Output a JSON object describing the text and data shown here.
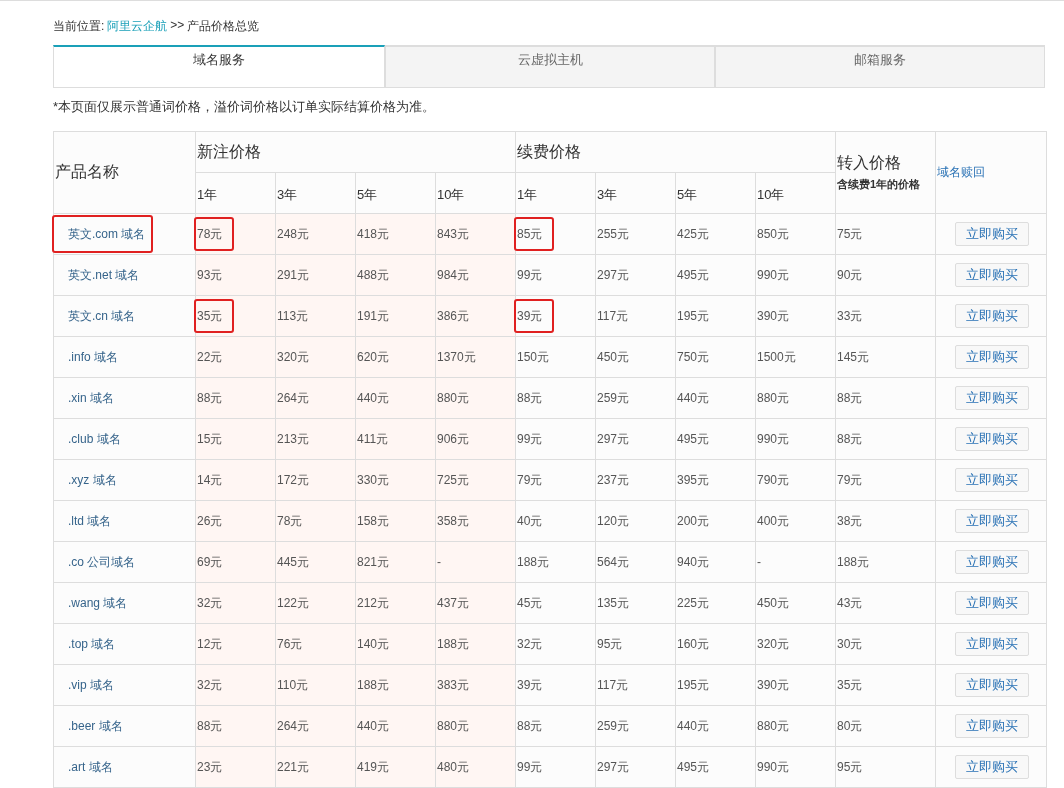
{
  "breadcrumb": {
    "label": "当前位置:",
    "link": "阿里云企航",
    "separator": ">>",
    "current": "产品价格总览"
  },
  "tabs": [
    {
      "label": "域名服务",
      "selected": true
    },
    {
      "label": "云虚拟主机",
      "selected": false
    },
    {
      "label": "邮箱服务",
      "selected": false
    }
  ],
  "note": "*本页面仅展示普通词价格，溢价词价格以订单实际结算价格为准。",
  "table": {
    "name_header": "产品名称",
    "new_header": "新注价格",
    "renew_header": "续费价格",
    "transfer_header": "转入价格",
    "transfer_sub": "含续费1年的价格",
    "redeem_link": "域名赎回",
    "new_years": [
      "1年",
      "3年",
      "5年",
      "10年"
    ],
    "renew_years": [
      "1年",
      "3年",
      "5年",
      "10年"
    ],
    "rows": [
      {
        "name": "英文.com 域名",
        "boxed": true,
        "new": [
          {
            "text": "78元",
            "boxed": true
          },
          {
            "text": "248元",
            "boxed": false
          },
          {
            "text": "418元",
            "boxed": false
          },
          {
            "text": "843元",
            "boxed": false
          }
        ],
        "renew": [
          {
            "text": "85元",
            "boxed": true
          },
          {
            "text": "255元",
            "boxed": false
          },
          {
            "text": "425元",
            "boxed": false
          },
          {
            "text": "850元",
            "boxed": false
          }
        ],
        "transfer": "75元",
        "button": "立即购买"
      },
      {
        "name": "英文.net 域名",
        "boxed": false,
        "new": [
          {
            "text": "93元",
            "boxed": false
          },
          {
            "text": "291元",
            "boxed": false
          },
          {
            "text": "488元",
            "boxed": false
          },
          {
            "text": "984元",
            "boxed": false
          }
        ],
        "renew": [
          {
            "text": "99元",
            "boxed": false
          },
          {
            "text": "297元",
            "boxed": false
          },
          {
            "text": "495元",
            "boxed": false
          },
          {
            "text": "990元",
            "boxed": false
          }
        ],
        "transfer": "90元",
        "button": "立即购买"
      },
      {
        "name": "英文.cn 域名",
        "boxed": false,
        "new": [
          {
            "text": "35元",
            "boxed": true
          },
          {
            "text": "113元",
            "boxed": false
          },
          {
            "text": "191元",
            "boxed": false
          },
          {
            "text": "386元",
            "boxed": false
          }
        ],
        "renew": [
          {
            "text": "39元",
            "boxed": true
          },
          {
            "text": "117元",
            "boxed": false
          },
          {
            "text": "195元",
            "boxed": false
          },
          {
            "text": "390元",
            "boxed": false
          }
        ],
        "transfer": "33元",
        "button": "立即购买"
      },
      {
        "name": ".info 域名",
        "boxed": false,
        "new": [
          {
            "text": "22元",
            "boxed": false
          },
          {
            "text": "320元",
            "boxed": false
          },
          {
            "text": "620元",
            "boxed": false
          },
          {
            "text": "1370元",
            "boxed": false
          }
        ],
        "renew": [
          {
            "text": "150元",
            "boxed": false
          },
          {
            "text": "450元",
            "boxed": false
          },
          {
            "text": "750元",
            "boxed": false
          },
          {
            "text": "1500元",
            "boxed": false
          }
        ],
        "transfer": "145元",
        "button": "立即购买"
      },
      {
        "name": ".xin 域名",
        "boxed": false,
        "new": [
          {
            "text": "88元",
            "boxed": false
          },
          {
            "text": "264元",
            "boxed": false
          },
          {
            "text": "440元",
            "boxed": false
          },
          {
            "text": "880元",
            "boxed": false
          }
        ],
        "renew": [
          {
            "text": "88元",
            "boxed": false
          },
          {
            "text": "259元",
            "boxed": false
          },
          {
            "text": "440元",
            "boxed": false
          },
          {
            "text": "880元",
            "boxed": false
          }
        ],
        "transfer": "88元",
        "button": "立即购买"
      },
      {
        "name": ".club 域名",
        "boxed": false,
        "new": [
          {
            "text": "15元",
            "boxed": false
          },
          {
            "text": "213元",
            "boxed": false
          },
          {
            "text": "411元",
            "boxed": false
          },
          {
            "text": "906元",
            "boxed": false
          }
        ],
        "renew": [
          {
            "text": "99元",
            "boxed": false
          },
          {
            "text": "297元",
            "boxed": false
          },
          {
            "text": "495元",
            "boxed": false
          },
          {
            "text": "990元",
            "boxed": false
          }
        ],
        "transfer": "88元",
        "button": "立即购买"
      },
      {
        "name": ".xyz 域名",
        "boxed": false,
        "new": [
          {
            "text": "14元",
            "boxed": false
          },
          {
            "text": "172元",
            "boxed": false
          },
          {
            "text": "330元",
            "boxed": false
          },
          {
            "text": "725元",
            "boxed": false
          }
        ],
        "renew": [
          {
            "text": "79元",
            "boxed": false
          },
          {
            "text": "237元",
            "boxed": false
          },
          {
            "text": "395元",
            "boxed": false
          },
          {
            "text": "790元",
            "boxed": false
          }
        ],
        "transfer": "79元",
        "button": "立即购买"
      },
      {
        "name": ".ltd 域名",
        "boxed": false,
        "new": [
          {
            "text": "26元",
            "boxed": false
          },
          {
            "text": "78元",
            "boxed": false
          },
          {
            "text": "158元",
            "boxed": false
          },
          {
            "text": "358元",
            "boxed": false
          }
        ],
        "renew": [
          {
            "text": "40元",
            "boxed": false
          },
          {
            "text": "120元",
            "boxed": false
          },
          {
            "text": "200元",
            "boxed": false
          },
          {
            "text": "400元",
            "boxed": false
          }
        ],
        "transfer": "38元",
        "button": "立即购买"
      },
      {
        "name": ".co 公司域名",
        "boxed": false,
        "new": [
          {
            "text": "69元",
            "boxed": false
          },
          {
            "text": "445元",
            "boxed": false
          },
          {
            "text": "821元",
            "boxed": false
          },
          {
            "text": "-",
            "boxed": false
          }
        ],
        "renew": [
          {
            "text": "188元",
            "boxed": false
          },
          {
            "text": "564元",
            "boxed": false
          },
          {
            "text": "940元",
            "boxed": false
          },
          {
            "text": "-",
            "boxed": false
          }
        ],
        "transfer": "188元",
        "button": "立即购买"
      },
      {
        "name": ".wang 域名",
        "boxed": false,
        "new": [
          {
            "text": "32元",
            "boxed": false
          },
          {
            "text": "122元",
            "boxed": false
          },
          {
            "text": "212元",
            "boxed": false
          },
          {
            "text": "437元",
            "boxed": false
          }
        ],
        "renew": [
          {
            "text": "45元",
            "boxed": false
          },
          {
            "text": "135元",
            "boxed": false
          },
          {
            "text": "225元",
            "boxed": false
          },
          {
            "text": "450元",
            "boxed": false
          }
        ],
        "transfer": "43元",
        "button": "立即购买"
      },
      {
        "name": ".top 域名",
        "boxed": false,
        "new": [
          {
            "text": "12元",
            "boxed": false
          },
          {
            "text": "76元",
            "boxed": false
          },
          {
            "text": "140元",
            "boxed": false
          },
          {
            "text": "188元",
            "boxed": false
          }
        ],
        "renew": [
          {
            "text": "32元",
            "boxed": false
          },
          {
            "text": "95元",
            "boxed": false
          },
          {
            "text": "160元",
            "boxed": false
          },
          {
            "text": "320元",
            "boxed": false
          }
        ],
        "transfer": "30元",
        "button": "立即购买"
      },
      {
        "name": ".vip 域名",
        "boxed": false,
        "new": [
          {
            "text": "32元",
            "boxed": false
          },
          {
            "text": "110元",
            "boxed": false
          },
          {
            "text": "188元",
            "boxed": false
          },
          {
            "text": "383元",
            "boxed": false
          }
        ],
        "renew": [
          {
            "text": "39元",
            "boxed": false
          },
          {
            "text": "117元",
            "boxed": false
          },
          {
            "text": "195元",
            "boxed": false
          },
          {
            "text": "390元",
            "boxed": false
          }
        ],
        "transfer": "35元",
        "button": "立即购买"
      },
      {
        "name": ".beer 域名",
        "boxed": false,
        "new": [
          {
            "text": "88元",
            "boxed": false
          },
          {
            "text": "264元",
            "boxed": false
          },
          {
            "text": "440元",
            "boxed": false
          },
          {
            "text": "880元",
            "boxed": false
          }
        ],
        "renew": [
          {
            "text": "88元",
            "boxed": false
          },
          {
            "text": "259元",
            "boxed": false
          },
          {
            "text": "440元",
            "boxed": false
          },
          {
            "text": "880元",
            "boxed": false
          }
        ],
        "transfer": "80元",
        "button": "立即购买"
      },
      {
        "name": ".art 域名",
        "boxed": false,
        "new": [
          {
            "text": "23元",
            "boxed": false
          },
          {
            "text": "221元",
            "boxed": false
          },
          {
            "text": "419元",
            "boxed": false
          },
          {
            "text": "480元",
            "boxed": false
          }
        ],
        "renew": [
          {
            "text": "99元",
            "boxed": false
          },
          {
            "text": "297元",
            "boxed": false
          },
          {
            "text": "495元",
            "boxed": false
          },
          {
            "text": "990元",
            "boxed": false
          }
        ],
        "transfer": "95元",
        "button": "立即购买"
      }
    ]
  }
}
